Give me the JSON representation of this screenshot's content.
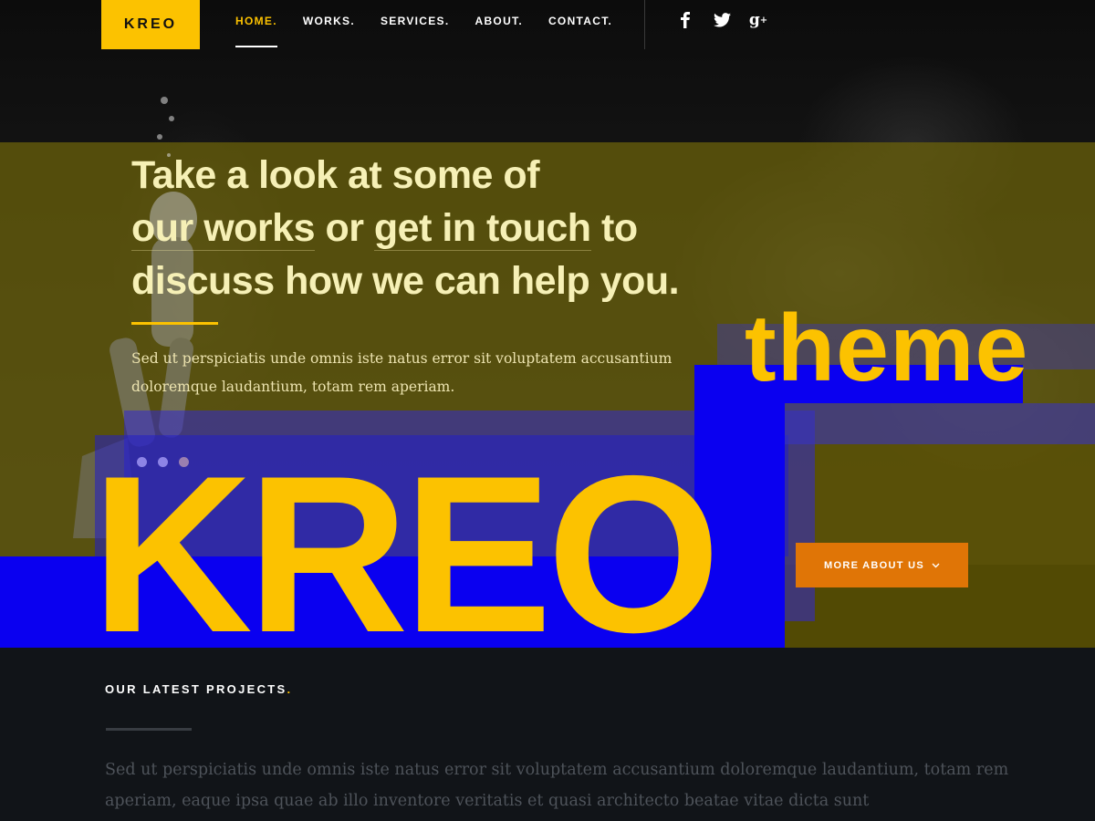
{
  "header": {
    "logo": "KREO",
    "nav": [
      {
        "label": "HOME.",
        "active": true
      },
      {
        "label": "WORKS.",
        "active": false
      },
      {
        "label": "SERVICES.",
        "active": false
      },
      {
        "label": "ABOUT.",
        "active": false
      },
      {
        "label": "CONTACT.",
        "active": false
      }
    ],
    "social": [
      {
        "icon": "facebook-icon",
        "glyph": "f"
      },
      {
        "icon": "twitter-icon",
        "glyph": "🐦"
      },
      {
        "icon": "google-plus-icon",
        "glyph": "g+"
      }
    ]
  },
  "hero": {
    "headline_lines": [
      {
        "text": "Take a look at some of"
      },
      {
        "link1": "our works",
        "mid": " or ",
        "link2": "get in touch",
        "end": " to"
      },
      {
        "text": "discuss how we can help you."
      }
    ],
    "paragraph": "Sed ut perspiciatis unde omnis iste natus error sit voluptatem accusantium doloremque laudantium, totam rem aperiam.",
    "slider_dots": 3,
    "button_label": "MORE ABOUT US",
    "button_icon": "chevron-down-icon"
  },
  "overlay": {
    "brand_big": "KREO",
    "brand_word": "theme"
  },
  "projects": {
    "title": "OUR LATEST PROJECTS",
    "title_accent": ".",
    "paragraph": "Sed ut perspiciatis unde omnis iste natus error sit voluptatem accusantium doloremque laudantium, totam rem aperiam, eaque ipsa quae ab illo inventore veritatis et quasi architecto beatae vitae dicta sunt"
  },
  "colors": {
    "accent_yellow": "#fcc200",
    "overlay_blue": "#0a00f0",
    "button_orange": "#e07506",
    "olive_band": "#6e640a",
    "dark_bg": "#111418"
  }
}
